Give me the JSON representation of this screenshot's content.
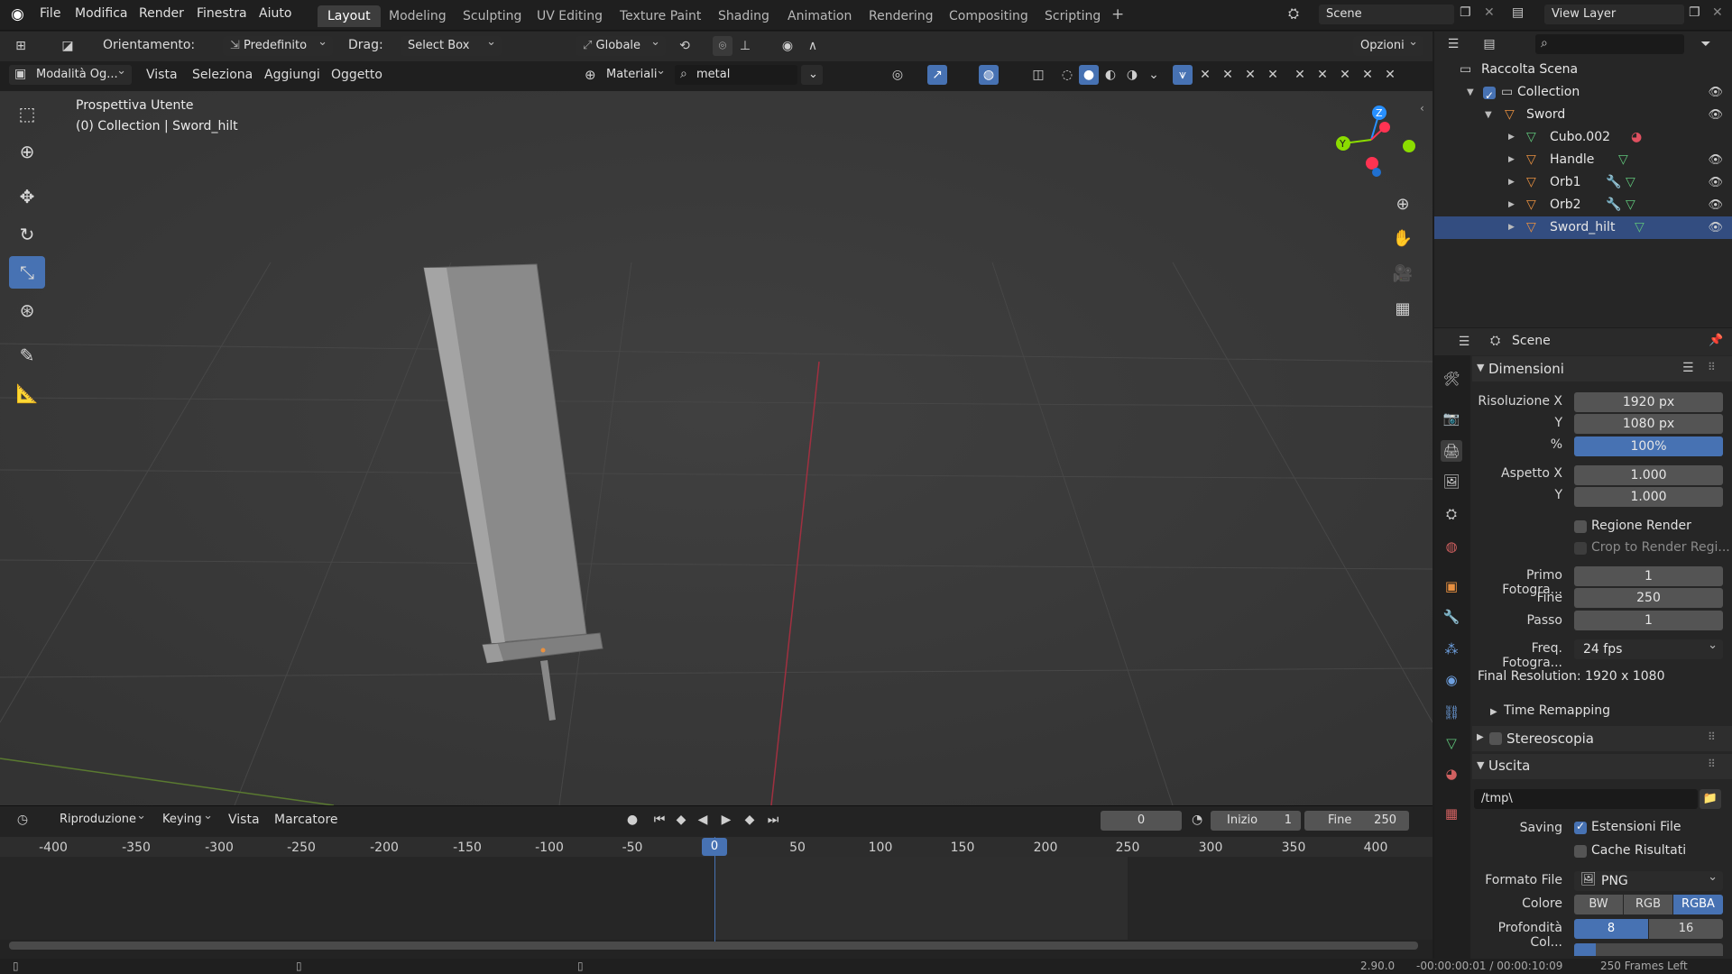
{
  "app": {
    "logo_glyph": "◉"
  },
  "menu": [
    "File",
    "Modifica",
    "Render",
    "Finestra",
    "Aiuto"
  ],
  "workspaces": [
    "Layout",
    "Modeling",
    "Sculpting",
    "UV Editing",
    "Texture Paint",
    "Shading",
    "Animation",
    "Rendering",
    "Compositing",
    "Scripting"
  ],
  "active_workspace": "Layout",
  "scene": {
    "scene_name": "Scene",
    "view_layer": "View Layer"
  },
  "header": {
    "orient_label": "Orientamento:",
    "orient_value": "Predefinito",
    "drag_label": "Drag:",
    "drag_value": "Select Box",
    "transform_orient": "Globale",
    "options": "Opzioni",
    "mode": "Modalità Og...",
    "view_menu": "Vista",
    "select_menu": "Seleziona",
    "add_menu": "Aggiungi",
    "object_menu": "Oggetto",
    "material_label": "Materiali",
    "search_value": "metal"
  },
  "viewport": {
    "overlay_title": "Prospettiva Utente",
    "overlay_subtitle": "(0) Collection | Sword_hilt",
    "axis_x_color": "#ff3352",
    "axis_y_color": "#8bdc00",
    "axis_z_color": "#2890ff"
  },
  "outliner": {
    "root": "Raccolta Scena",
    "collection": "Collection",
    "parent": "Sword",
    "children": [
      "Cubo.002",
      "Handle",
      "Orb1",
      "Orb2",
      "Sword_hilt"
    ]
  },
  "properties": {
    "breadcrumb": "Scene",
    "section_dimensions": "Dimensioni",
    "res_x_label": "Risoluzione X",
    "res_x": "1920 px",
    "res_y_label": "Y",
    "res_y": "1080 px",
    "percent_label": "%",
    "percent": "100%",
    "aspect_x_label": "Aspetto X",
    "aspect_x": "1.000",
    "aspect_y_label": "Y",
    "aspect_y": "1.000",
    "render_region": "Regione Render",
    "crop_region": "Crop to Render Regi...",
    "frame_start_label": "Primo Fotogra...",
    "frame_start": "1",
    "frame_end_label": "Fine",
    "frame_end": "250",
    "frame_step_label": "Passo",
    "frame_step": "1",
    "fps_label": "Freq. Fotogra...",
    "fps": "24 fps",
    "final_res": "Final Resolution: 1920 x 1080",
    "time_remapping": "Time Remapping",
    "stereoscopy": "Stereoscopia",
    "section_output": "Uscita",
    "output_path": "/tmp\\",
    "saving_label": "Saving",
    "file_ext": "Estensioni File",
    "cache_result": "Cache Risultati",
    "file_format_label": "Formato File",
    "file_format": "PNG",
    "color_label": "Colore",
    "color_options": [
      "BW",
      "RGB",
      "RGBA"
    ],
    "color_selected": "RGBA",
    "depth_label": "Profondità Col...",
    "depth_options": [
      "8",
      "16"
    ],
    "depth_selected": "8"
  },
  "timeline": {
    "playback_menu": "Riproduzione",
    "keying_menu": "Keying",
    "view_menu": "Vista",
    "marker_menu": "Marcatore",
    "current_frame": "0",
    "start_label": "Inizio",
    "start": "1",
    "end_label": "Fine",
    "end": "250",
    "ticks": [
      "-400",
      "-350",
      "-300",
      "-250",
      "-200",
      "-150",
      "-100",
      "-50",
      "0",
      "50",
      "100",
      "150",
      "200",
      "250",
      "300",
      "350",
      "400"
    ],
    "playhead_label": "0"
  },
  "status": {
    "version": "2.90.0",
    "time": "-00:00:00:01 / 00:00:10:09",
    "frames_left": "250 Frames Left"
  }
}
